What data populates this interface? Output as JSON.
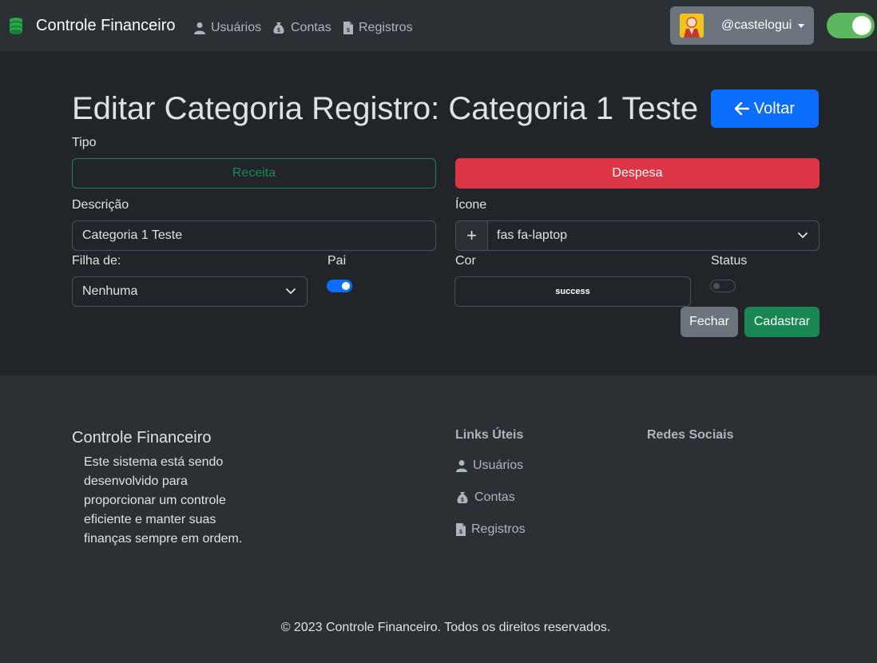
{
  "navbar": {
    "brand": "Controle Financeiro",
    "brand_icon": "coins-icon",
    "links": [
      {
        "label": "Usuários",
        "icon": "user-icon"
      },
      {
        "label": "Contas",
        "icon": "money-bag-icon"
      },
      {
        "label": "Registros",
        "icon": "invoice-icon"
      }
    ],
    "username": "@castelogui",
    "theme_toggle_on": true
  },
  "page": {
    "title": "Editar Categoria Registro: Categoria 1 Teste",
    "back_button": "Voltar"
  },
  "form": {
    "tipo_label": "Tipo",
    "receita": "Receita",
    "despesa": "Despesa",
    "descricao_label": "Descrição",
    "descricao_value": "Categoria 1 Teste",
    "icone_label": "Ícone",
    "icone_addon": "+",
    "icone_value": "fas fa-laptop",
    "filha_label": "Filha de:",
    "filha_value": "Nenhuma",
    "pai_label": "Pai",
    "pai_on": true,
    "cor_label": "Cor",
    "cor_value": "success",
    "status_label": "Status",
    "status_on": false,
    "fechar": "Fechar",
    "cadastrar": "Cadastrar"
  },
  "footer": {
    "title": "Controle Financeiro",
    "description": "Este sistema está sendo desenvolvido para proporcionar um controle eficiente e manter suas finanças sempre em ordem.",
    "links_heading": "Links Úteis",
    "links": [
      {
        "label": "Usuários",
        "icon": "user-icon"
      },
      {
        "label": "Contas",
        "icon": "money-bag-icon"
      },
      {
        "label": "Registros",
        "icon": "invoice-icon"
      }
    ],
    "social_heading": "Redes Sociais",
    "copyright": "© 2023 Controle Financeiro. Todos os direitos reservados."
  },
  "colors": {
    "primary": "#0d6efd",
    "success": "#198754",
    "danger": "#dc3545",
    "secondary": "#6c757d"
  }
}
